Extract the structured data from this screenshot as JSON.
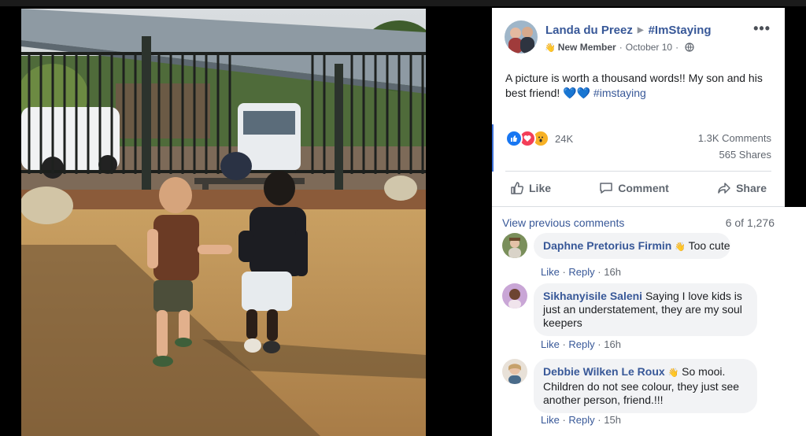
{
  "post": {
    "author": "Landa du Preez",
    "group": "#ImStaying",
    "badge": "New Member",
    "date": "October 10",
    "text_before": "A picture is worth a thousand words!! My son and his best friend! ",
    "hearts": "💙💙",
    "hashtag": "#imstaying",
    "more": "•••"
  },
  "stats": {
    "reactions_count": "24K",
    "comments": "1.3K Comments",
    "shares": "565 Shares",
    "reaction_icons": [
      "like-icon",
      "love-icon",
      "wow-icon"
    ]
  },
  "actions": {
    "like": "Like",
    "comment": "Comment",
    "share": "Share"
  },
  "comments_header": {
    "view_previous": "View previous comments",
    "count": "6 of 1,276"
  },
  "comments": [
    {
      "name": "Daphne Pretorius Firmin",
      "text": "Too cute",
      "like": "Like",
      "reply": "Reply",
      "time": "16h"
    },
    {
      "name": "Sikhanyisile Saleni",
      "text": "Saying I love kids is just an understatement, they are my soul keepers",
      "like": "Like",
      "reply": "Reply",
      "time": "16h"
    },
    {
      "name": "Debbie Wilken Le Roux",
      "text": "So mooi. Children do not see colour, they just see another person, friend.!!!",
      "like": "Like",
      "reply": "Reply",
      "time": "15h"
    }
  ],
  "colors": {
    "link": "#385898",
    "like_blue": "#1877f2",
    "love_red": "#f33e58",
    "wow_yellow": "#f7b125"
  }
}
